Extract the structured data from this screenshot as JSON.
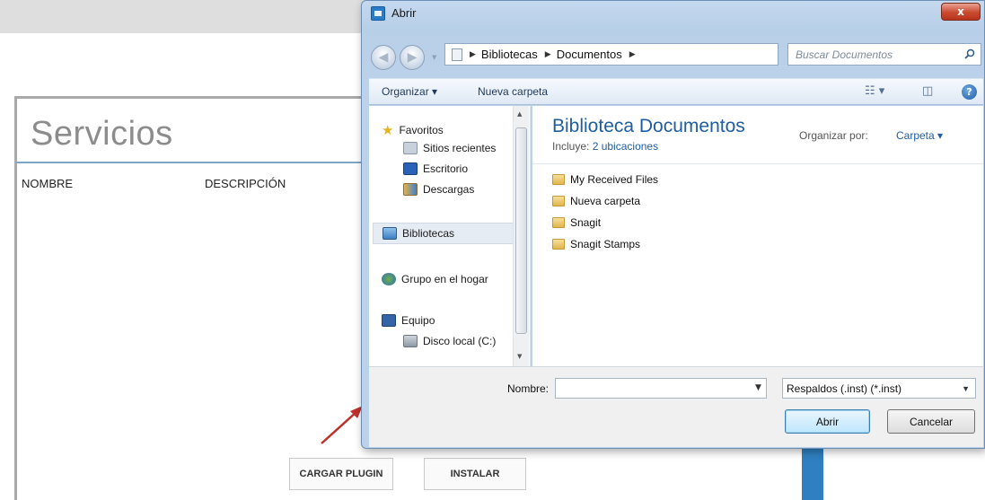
{
  "background_app": {
    "title": "Servicios",
    "columns": [
      "NOMBRE",
      "DESCRIPCIÓN"
    ],
    "buttons": {
      "load_plugin": "CARGAR PLUGIN",
      "install": "INSTALAR"
    }
  },
  "dialog": {
    "title": "Abrir",
    "close_label": "x",
    "breadcrumb": [
      "Bibliotecas",
      "Documentos"
    ],
    "search_placeholder": "Buscar Documentos",
    "toolbar": {
      "organize": "Organizar ▾",
      "new_folder": "Nueva carpeta"
    },
    "sidebar": {
      "favorites": "Favoritos",
      "recent": "Sitios recientes",
      "desktop": "Escritorio",
      "downloads": "Descargas",
      "libraries": "Bibliotecas",
      "homegroup": "Grupo en el hogar",
      "computer": "Equipo",
      "local_disk": "Disco local (C:)"
    },
    "content": {
      "title": "Biblioteca Documentos",
      "includes_label": "Incluye:",
      "includes_link": "2 ubicaciones",
      "arrange_label": "Organizar por:",
      "arrange_value": "Carpeta ▾",
      "files": [
        "My Received Files",
        "Nueva carpeta",
        "Snagit",
        "Snagit Stamps"
      ]
    },
    "filename_label": "Nombre:",
    "filename_value": "",
    "filter_value": "Respaldos (.inst) (*.inst)",
    "open_button": "Abrir",
    "cancel_button": "Cancelar"
  },
  "colors": {
    "accent": "#1e5ea0",
    "close": "#c94a2f",
    "arrow": "#c0302a"
  }
}
